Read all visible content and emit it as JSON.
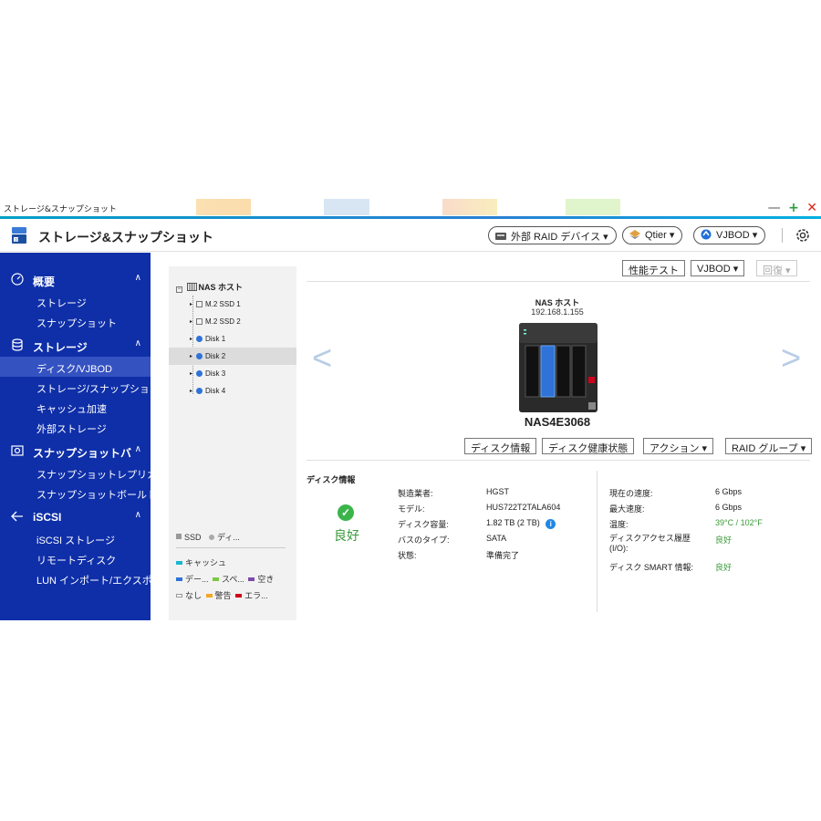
{
  "window": {
    "title": "ストレージ&スナップショット",
    "controls": {
      "minimize": "—",
      "maximize": "+",
      "close": "✕"
    }
  },
  "app": {
    "title": "ストレージ&スナップショット",
    "header_buttons": {
      "external_raid": "外部 RAID デバイス ▾",
      "qtier": "Qtier ▾",
      "vjbod": "VJBOD ▾"
    }
  },
  "sidebar": {
    "groups": [
      {
        "label": "概要",
        "items": [
          "ストレージ",
          "スナップショット"
        ]
      },
      {
        "label": "ストレージ",
        "items": [
          "ディスク/VJBOD",
          "ストレージ/スナップショ",
          "キャッシュ加速",
          "外部ストレージ"
        ]
      },
      {
        "label": "スナップショットバ",
        "items": [
          "スナップショットレプリカ",
          "スナップショットボールト"
        ]
      },
      {
        "label": "iSCSI",
        "items": [
          "iSCSI ストレージ",
          "リモートディスク",
          "LUN インポート/エクスポ"
        ]
      }
    ],
    "active_item": "ディスク/VJBOD"
  },
  "tree": {
    "root": "NAS ホスト",
    "items": [
      "M.2 SSD 1",
      "M.2 SSD 2",
      "Disk 1",
      "Disk 2",
      "Disk 3",
      "Disk 4"
    ],
    "selected": "Disk 2",
    "legend": {
      "row1": [
        "SSD",
        "ディ..."
      ],
      "row2": [
        "キャッシュ"
      ],
      "row3": [
        "デー...",
        "スペ...",
        "空き"
      ],
      "row4": [
        "なし",
        "警告",
        "エラ..."
      ]
    }
  },
  "toolbar": {
    "perf_test": "性能テスト",
    "vjbod": "VJBOD ▾",
    "restore": "回復 ▾"
  },
  "nas": {
    "name": "NAS ホスト",
    "ip": "192.168.1.155",
    "model": "NAS4E3068"
  },
  "disk_actions": {
    "disk_info": "ディスク情報",
    "disk_health": "ディスク健康状態",
    "action": "アクション ▾",
    "raid_group": "RAID グループ ▾"
  },
  "disk_info": {
    "section_title": "ディスク情報",
    "status": "良好",
    "left": [
      {
        "label": "製造業者:",
        "value": "HGST"
      },
      {
        "label": "モデル:",
        "value": "HUS722T2TALA604"
      },
      {
        "label": "ディスク容量:",
        "value": "1.82 TB (2 TB)"
      },
      {
        "label": "バスのタイプ:",
        "value": "SATA"
      },
      {
        "label": "状態:",
        "value": "準備完了"
      }
    ],
    "right": [
      {
        "label": "現在の速度:",
        "value": "6 Gbps"
      },
      {
        "label": "最大速度:",
        "value": "6 Gbps"
      },
      {
        "label": "温度:",
        "value": "39°C / 102°F"
      },
      {
        "label": "ディスクアクセス履歴 (I/O):",
        "value": "良好"
      },
      {
        "label": "ディスク SMART 情報:",
        "value": "良好"
      }
    ]
  },
  "colors": {
    "sidebar_bg": "#0f2fa8",
    "sidebar_active": "#3552c1",
    "status_good": "#3a9a3a",
    "disk_dot": "#2f72d8",
    "info_icon": "#1e88e5"
  }
}
